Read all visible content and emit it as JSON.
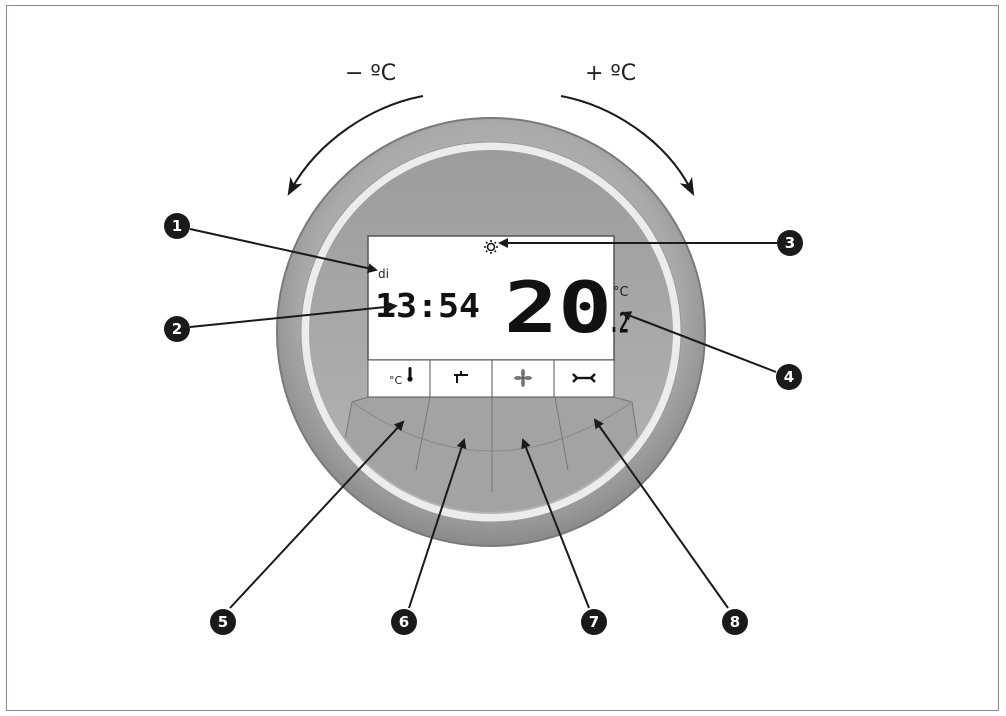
{
  "rotation": {
    "minus_label": "− ºC",
    "plus_label": "+ ºC"
  },
  "display": {
    "day": "di",
    "time": "13:54",
    "temp_main": "20",
    "temp_decimal": ".2",
    "temp_unit": "°C",
    "mode_icon": "sun-icon"
  },
  "buttons": [
    {
      "icon": "thermometer-icon",
      "text": "°C"
    },
    {
      "icon": "tap-icon",
      "text": ""
    },
    {
      "icon": "fan-icon",
      "text": ""
    },
    {
      "icon": "wrench-icon",
      "text": ""
    }
  ],
  "callouts": [
    "1",
    "2",
    "3",
    "4",
    "5",
    "6",
    "7",
    "8"
  ],
  "colors": {
    "bezel_outer": "#8e8e8e",
    "bezel_inner": "#bdbdbd",
    "face": "#a8a8a8",
    "lcd": "#ffffff",
    "badge": "#1a1a1a"
  }
}
